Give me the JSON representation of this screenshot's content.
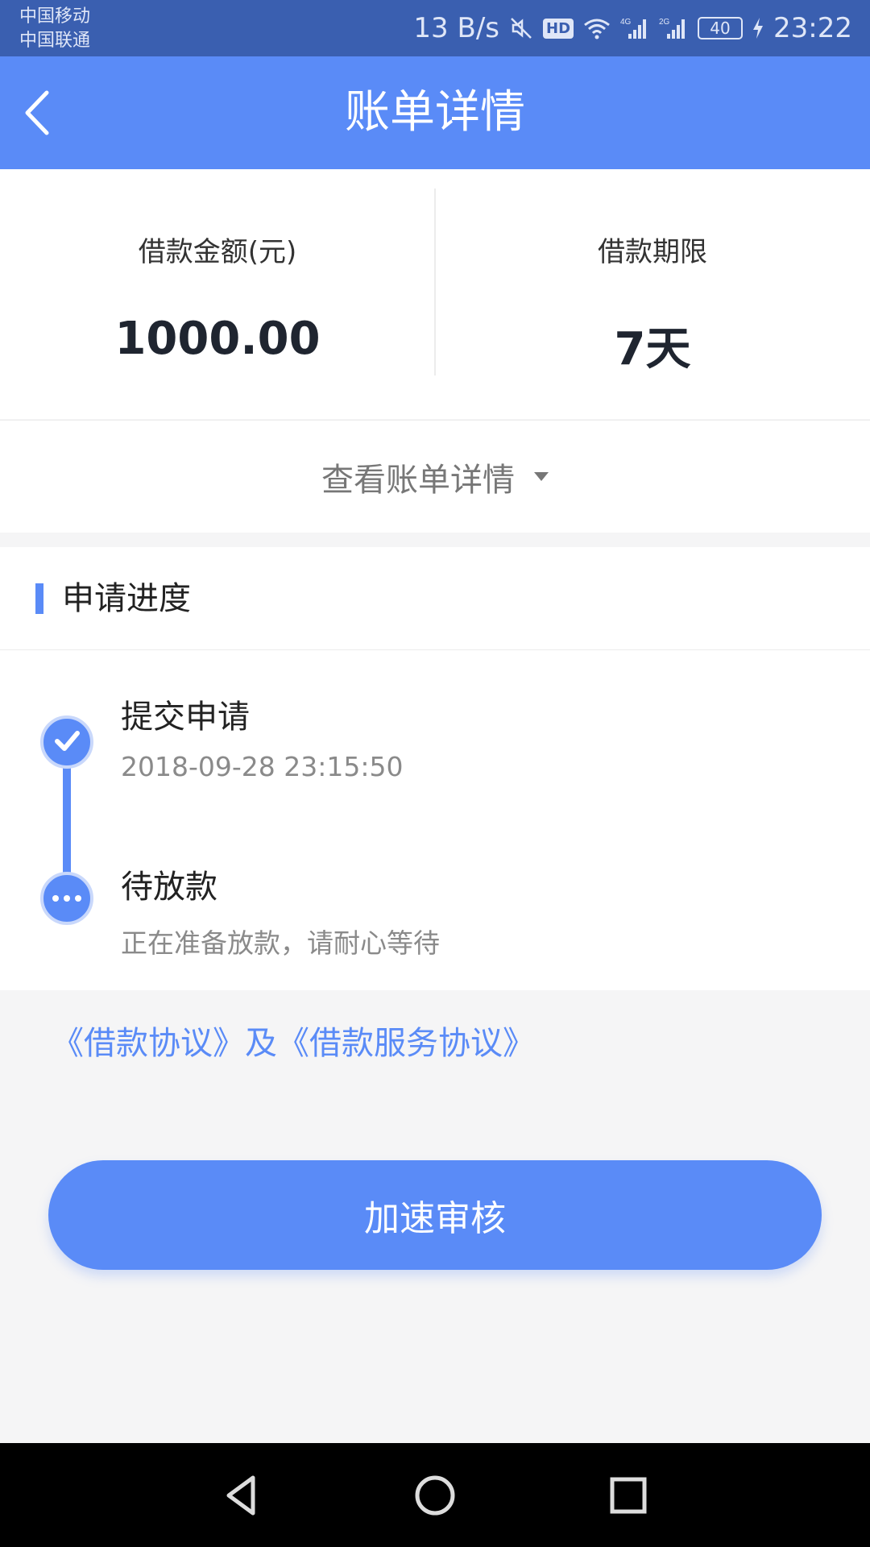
{
  "status_bar": {
    "carrier_1": "中国移动",
    "carrier_2": "中国联通",
    "network_speed": "13 B/s",
    "hd_label": "HD",
    "network_4g": "4G",
    "network_2g": "2G",
    "battery_level": "40",
    "time": "23:22",
    "icons": [
      "mute-icon",
      "hd-icon",
      "wifi-icon",
      "signal-4g-icon",
      "signal-2g-icon",
      "battery-icon",
      "charging-icon"
    ]
  },
  "app_bar": {
    "title": "账单详情",
    "back_icon": "chevron-left-icon"
  },
  "summary": {
    "amount_label": "借款金额(元)",
    "amount_value": "1000.00",
    "term_label": "借款期限",
    "term_value": "7天"
  },
  "details_toggle": {
    "label": "查看账单详情",
    "icon": "caret-down-icon"
  },
  "progress": {
    "section_title": "申请进度",
    "accent_color": "#5a8bf7",
    "steps": [
      {
        "title": "提交申请",
        "subtitle": "2018-09-28 23:15:50",
        "icon": "check-icon",
        "status": "done"
      },
      {
        "title": "待放款",
        "subtitle": "正在准备放款，请耐心等待",
        "icon": "more-dots-icon",
        "status": "pending"
      }
    ]
  },
  "agreement_link": "《借款协议》及《借款服务协议》",
  "primary_button": "加速审核",
  "nav_bar": {
    "icons": [
      "back-triangle-icon",
      "home-circle-icon",
      "recent-square-icon"
    ]
  }
}
